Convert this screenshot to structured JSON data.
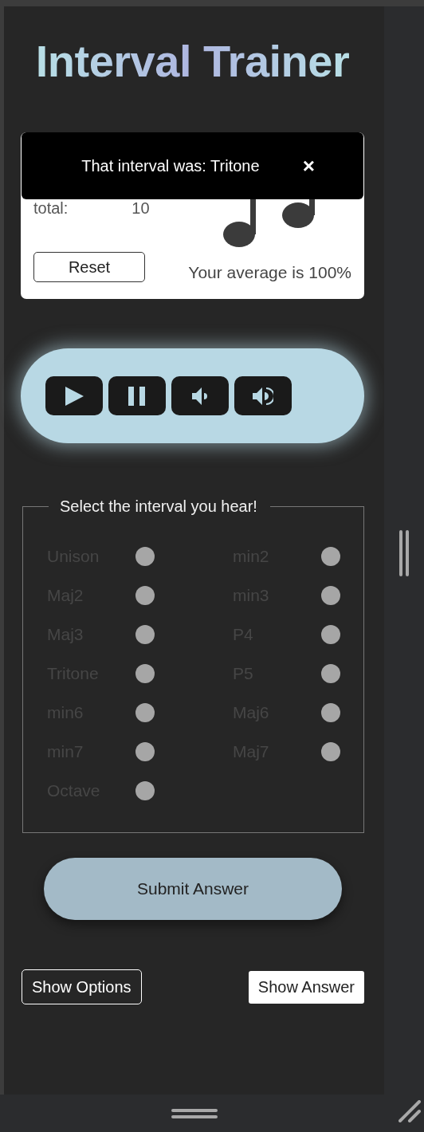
{
  "title": "Interval Trainer",
  "toast": {
    "message": "That interval was: Tritone",
    "close": "×"
  },
  "score": {
    "label": "total:",
    "value": "10",
    "reset": "Reset",
    "average": "Your average is 100%"
  },
  "player": {
    "buttons": [
      {
        "kind": "play"
      },
      {
        "kind": "pause"
      },
      {
        "kind": "volume-down"
      },
      {
        "kind": "volume-up"
      }
    ]
  },
  "intervals": {
    "legend": "Select the interval you hear!",
    "options": [
      {
        "label": "Unison",
        "selected": false,
        "disabled": true
      },
      {
        "label": "min2",
        "selected": false,
        "disabled": true
      },
      {
        "label": "Maj2",
        "selected": false,
        "disabled": true
      },
      {
        "label": "min3",
        "selected": false,
        "disabled": true
      },
      {
        "label": "Maj3",
        "selected": false,
        "disabled": true
      },
      {
        "label": "P4",
        "selected": false,
        "disabled": true
      },
      {
        "label": "Tritone",
        "selected": false,
        "disabled": true
      },
      {
        "label": "P5",
        "selected": false,
        "disabled": true
      },
      {
        "label": "min6",
        "selected": false,
        "disabled": true
      },
      {
        "label": "Maj6",
        "selected": false,
        "disabled": true
      },
      {
        "label": "min7",
        "selected": false,
        "disabled": true
      },
      {
        "label": "Maj7",
        "selected": false,
        "disabled": true
      },
      {
        "label": "Octave",
        "selected": false,
        "disabled": true
      }
    ]
  },
  "submit": "Submit Answer",
  "footer": {
    "show_options": "Show Options",
    "show_answer": "Show Answer"
  }
}
